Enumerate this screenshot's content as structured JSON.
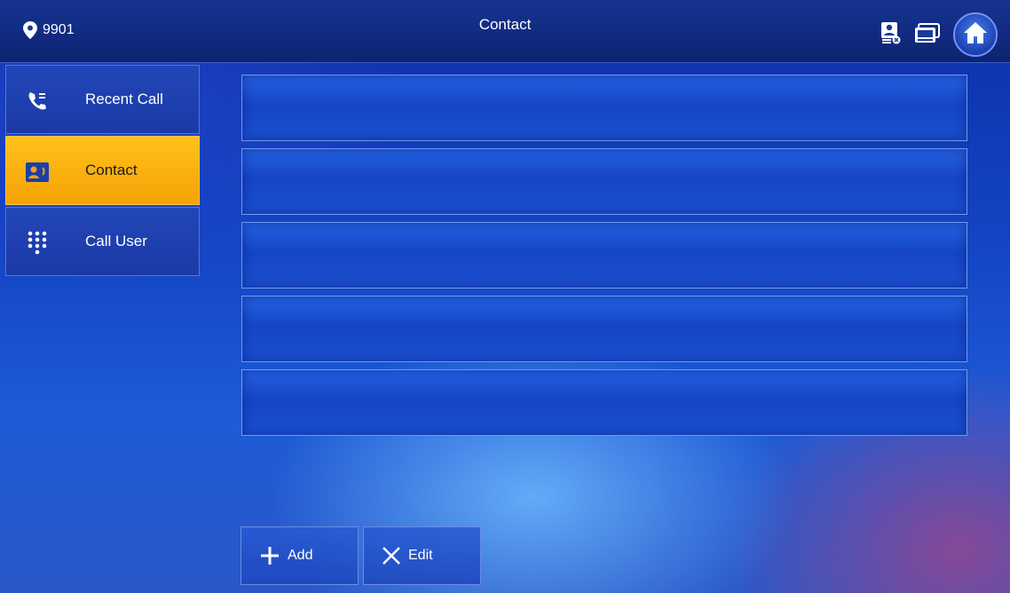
{
  "header": {
    "location": "9901",
    "title": "Contact",
    "icons": [
      "card-reader-icon",
      "monitor-icon",
      "home-icon"
    ]
  },
  "sidebar": {
    "items": [
      {
        "label": "Recent Call",
        "icon": "phone-log-icon",
        "active": false
      },
      {
        "label": "Contact",
        "icon": "contact-card-icon",
        "active": true
      },
      {
        "label": "Call User",
        "icon": "dialpad-icon",
        "active": false
      }
    ]
  },
  "contacts": {
    "rows": [
      "",
      "",
      "",
      "",
      ""
    ]
  },
  "actions": {
    "add_label": "Add",
    "edit_label": "Edit"
  },
  "colors": {
    "active_tab": "#f6a106",
    "header": "#112a80",
    "row": "#1a4fcf"
  }
}
